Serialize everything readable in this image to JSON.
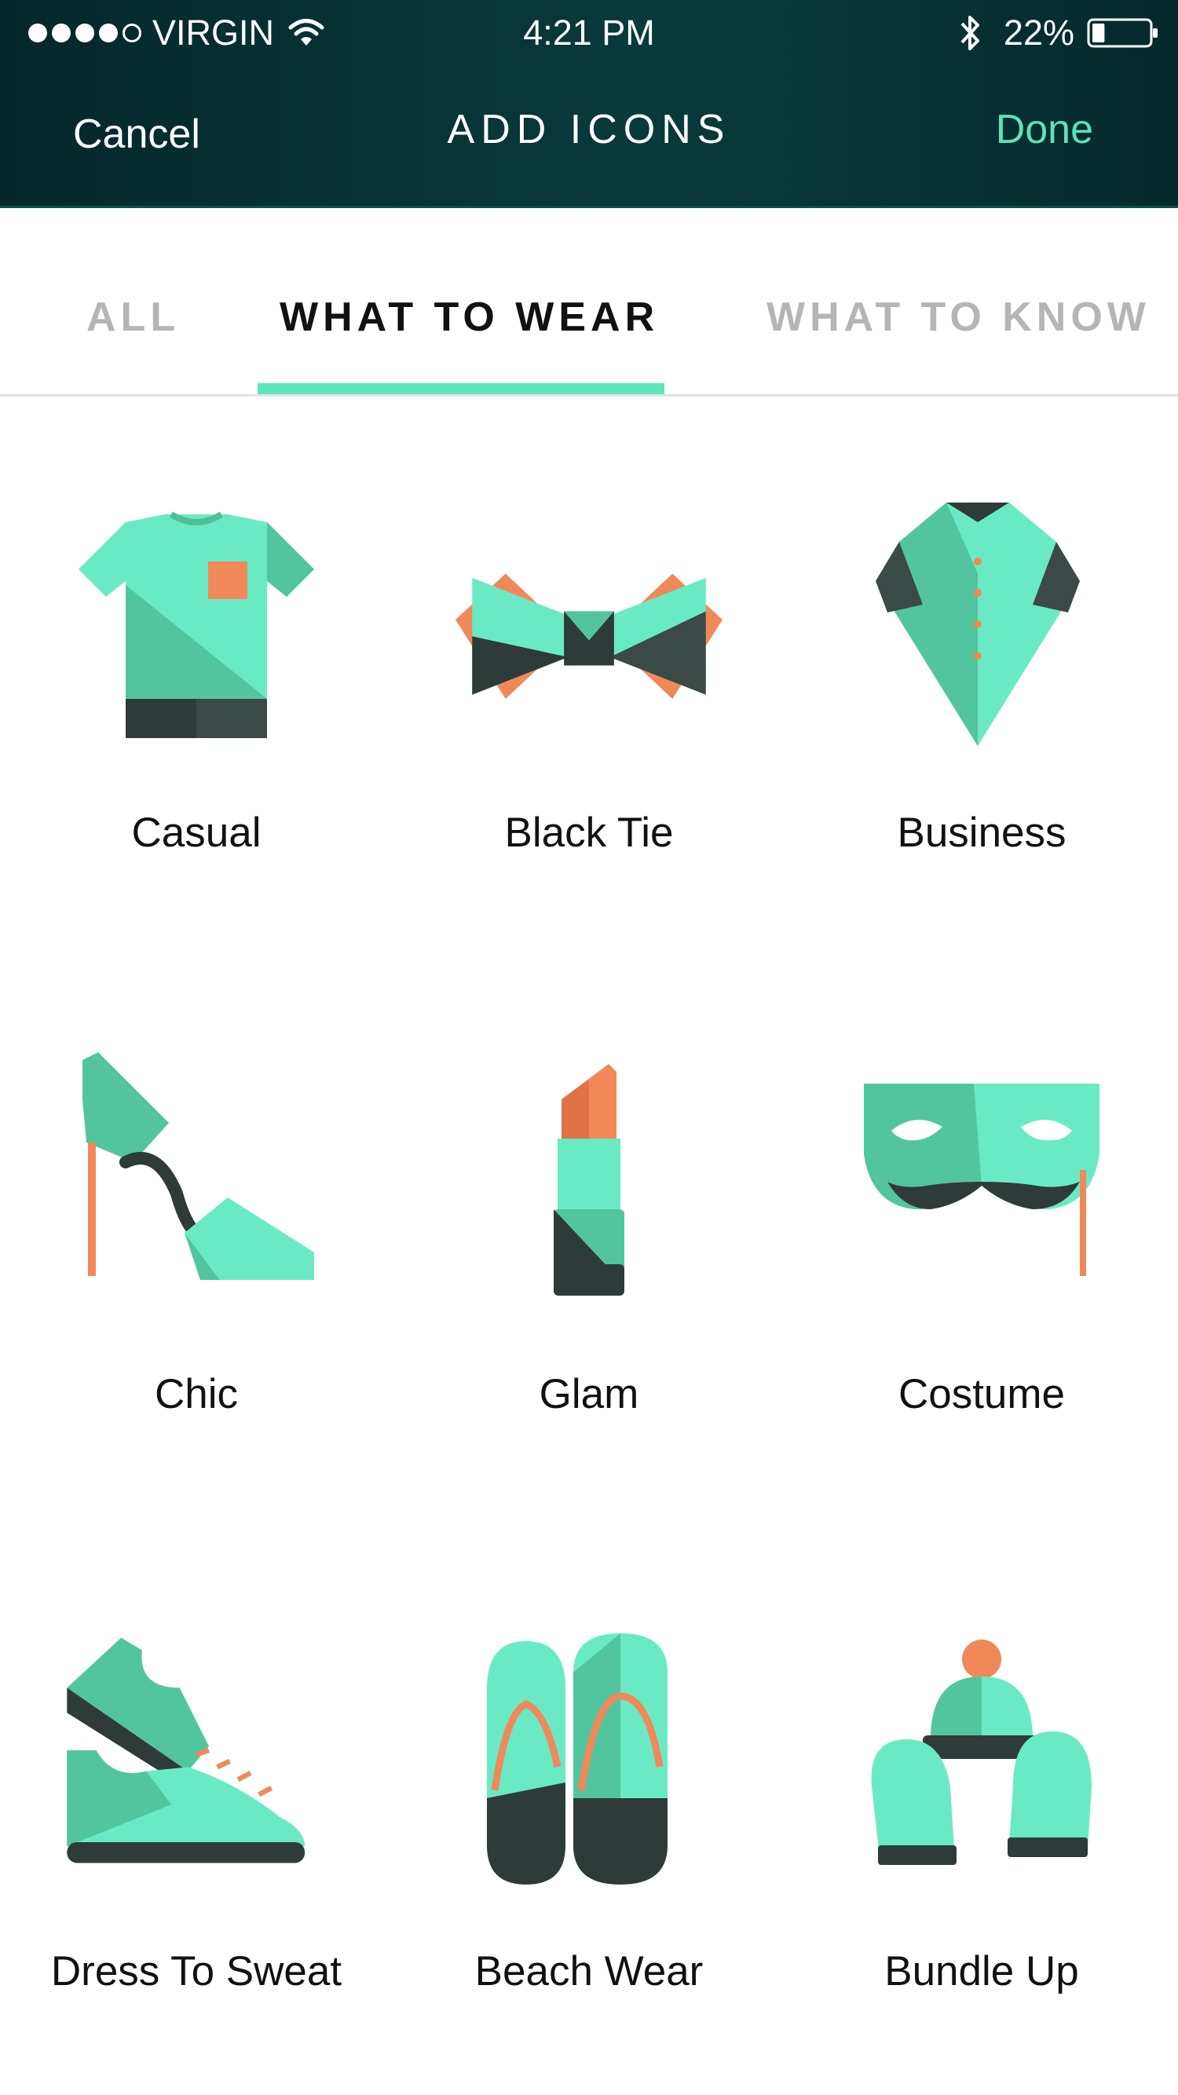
{
  "status_bar": {
    "carrier": "VIRGIN",
    "time": "4:21 PM",
    "battery_percent": "22%",
    "battery_level": 0.22,
    "signal_bars": 4,
    "signal_max": 5
  },
  "nav": {
    "cancel_label": "Cancel",
    "title": "ADD ICONS",
    "done_label": "Done"
  },
  "tabs": [
    {
      "label": "ALL",
      "active": false
    },
    {
      "label": "WHAT TO WEAR",
      "active": true
    },
    {
      "label": "WHAT TO KNOW",
      "active": false
    }
  ],
  "icons": [
    {
      "label": "Casual",
      "icon": "t-shirt-icon"
    },
    {
      "label": "Black Tie",
      "icon": "bow-tie-icon"
    },
    {
      "label": "Business",
      "icon": "suit-jacket-icon"
    },
    {
      "label": "Chic",
      "icon": "high-heel-icon"
    },
    {
      "label": "Glam",
      "icon": "lipstick-icon"
    },
    {
      "label": "Costume",
      "icon": "masquerade-mask-icon"
    },
    {
      "label": "Dress To Sweat",
      "icon": "sneakers-icon"
    },
    {
      "label": "Beach Wear",
      "icon": "flip-flops-icon"
    },
    {
      "label": "Bundle Up",
      "icon": "beanie-mittens-icon"
    }
  ],
  "colors": {
    "header_bg": "#05272a",
    "accent": "#5de3b5",
    "mint": "#6aeac4",
    "mint_dark": "#4fbf96",
    "charcoal": "#2e3b39",
    "coral": "#f0885a"
  }
}
